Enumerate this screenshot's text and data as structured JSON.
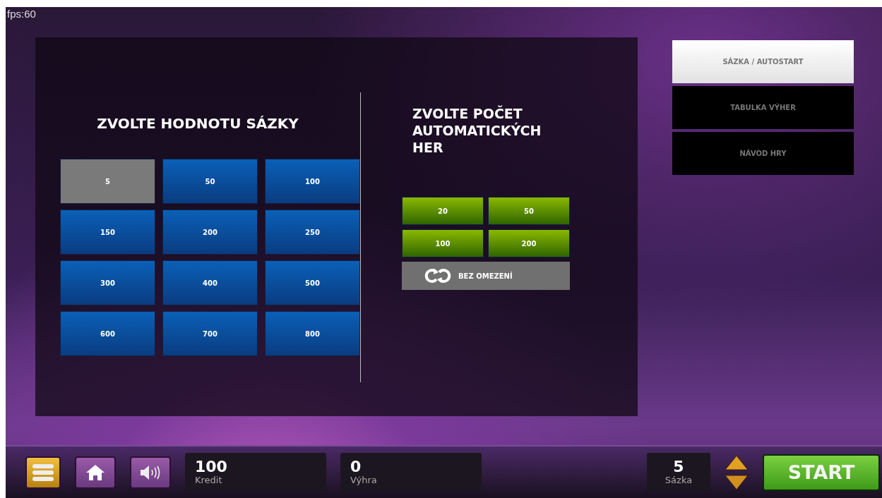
{
  "fps": "fps:60",
  "bet_panel": {
    "title": "ZVOLTE HODNOTU SÁZKY",
    "options": [
      {
        "label": "5",
        "selected": true
      },
      {
        "label": "50",
        "selected": false
      },
      {
        "label": "100",
        "selected": false
      },
      {
        "label": "150",
        "selected": false
      },
      {
        "label": "200",
        "selected": false
      },
      {
        "label": "250",
        "selected": false
      },
      {
        "label": "300",
        "selected": false
      },
      {
        "label": "400",
        "selected": false
      },
      {
        "label": "500",
        "selected": false
      },
      {
        "label": "600",
        "selected": false
      },
      {
        "label": "700",
        "selected": false
      },
      {
        "label": "800",
        "selected": false
      }
    ]
  },
  "autoplay_panel": {
    "title": "ZVOLTE POČET AUTOMATICKÝCH HER",
    "options": [
      {
        "label": "20",
        "selected": false
      },
      {
        "label": "50",
        "selected": false
      },
      {
        "label": "100",
        "selected": false
      },
      {
        "label": "200",
        "selected": false
      }
    ],
    "unlimited": {
      "label": "BEZ OMEZENÍ",
      "selected": true
    }
  },
  "tabs": [
    {
      "label": "SÁZKA / AUTOSTART",
      "selected": true
    },
    {
      "label": "TABULKA VÝHER",
      "selected": false
    },
    {
      "label": "NÁVOD HRY",
      "selected": false
    }
  ],
  "bottom_bar": {
    "credit": {
      "value": "100",
      "label": "Kredit"
    },
    "win": {
      "value": "0",
      "label": "Výhra"
    },
    "bet": {
      "value": "5",
      "label": "Sázka"
    },
    "start": "START"
  }
}
